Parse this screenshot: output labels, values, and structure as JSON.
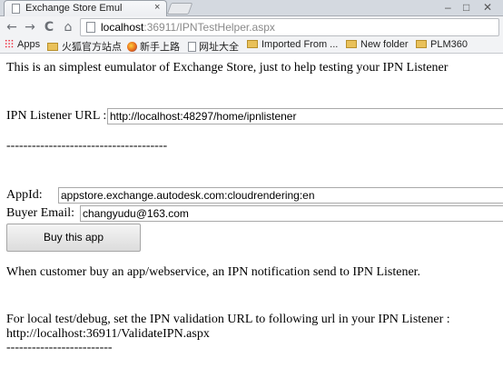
{
  "browser": {
    "tab_title": "Exchange Store Emul",
    "tab_close": "×",
    "url_host": "localhost",
    "url_rest": ":36911/IPNTestHelper.aspx",
    "nav": {
      "back": "←",
      "forward": "→",
      "reload": "C",
      "home": "⌂"
    }
  },
  "bookmarks": {
    "apps": "Apps",
    "items": [
      "火狐官方站点",
      "新手上路",
      "网址大全",
      "Imported From ...",
      "New folder",
      "PLM360"
    ]
  },
  "page": {
    "intro": "This is an simplest eumulator of Exchange Store, just to help testing your IPN Listener",
    "ipn_label": "IPN Listener URL :",
    "ipn_value": "http://localhost:48297/home/ipnlistener",
    "separator1": "--------------------------------------",
    "appid_label": "AppId:",
    "appid_value": "appstore.exchange.autodesk.com:cloudrendering:en",
    "buyer_label": "Buyer Email:",
    "buyer_value": "changyudu@163.com",
    "buy_button": "Buy this app",
    "notice": "When customer buy an app/webservice, an IPN notification send to IPN Listener.",
    "local_note": "For local test/debug, set the IPN validation URL to following url in your IPN Listener :",
    "validate_url": "http://localhost:36911/ValidateIPN.aspx",
    "separator2": "-------------------------"
  }
}
